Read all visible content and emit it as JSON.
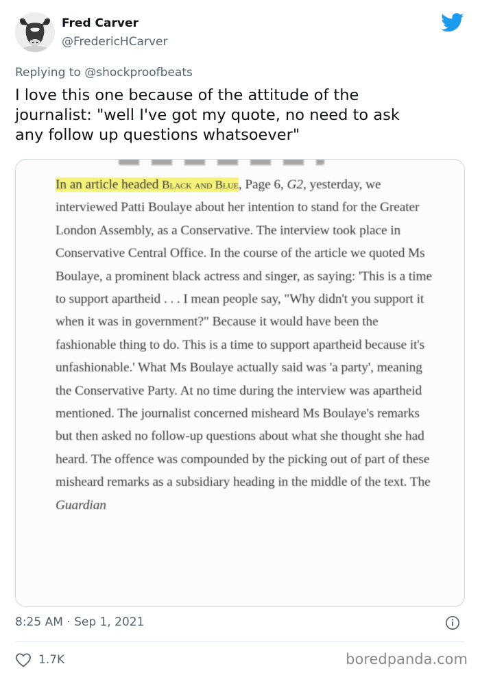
{
  "author": {
    "name": "Fred Carver",
    "handle": "@FredericHCarver"
  },
  "reply": {
    "prefix": "Replying to ",
    "mention": "@shockproofbeats"
  },
  "tweet": {
    "text": "I love this one because of the attitude of the\njournalist: \"well I've got my quote, no need to ask\nany follow up questions whatsoever\""
  },
  "clipping": {
    "l1a": "In an article headed ",
    "l1b": "Black and Blue",
    "l1c": ", Page 6, ",
    "l1d": "G2",
    "l1e": ",",
    "body": "yesterday, we interviewed Patti Boulaye about her intention to stand for the Greater London Assembly, as a Conservative. The interview took place in Conservative Central Office. In the course of the article we quoted Ms Boulaye, a prominent black actress and singer, as saying: 'This is a time to support apartheid . . . I mean people say, \"Why didn't you support it when it was in government?\" Because it would have been the fashionable thing to do. This is a time to support apartheid because it's unfashionable.' What Ms Boulaye actually said was 'a party', meaning the Conservative Party. At no time during the interview was apartheid mentioned. The journalist concerned misheard Ms Boulaye's remarks but then asked no follow-up questions about what she thought she had heard. The offence was compounded by the picking out of part of these misheard remarks as a subsidiary heading in the middle of the text. The ",
    "tail": "Guardian",
    "highlight_color": "#f5f37a"
  },
  "meta": {
    "timestamp": "8:25 AM · Sep 1, 2021",
    "likes": "1.7K"
  },
  "watermark": "boredpanda.com",
  "colors": {
    "twitter_blue": "#1d9bf0",
    "secondary_text": "#536471"
  }
}
